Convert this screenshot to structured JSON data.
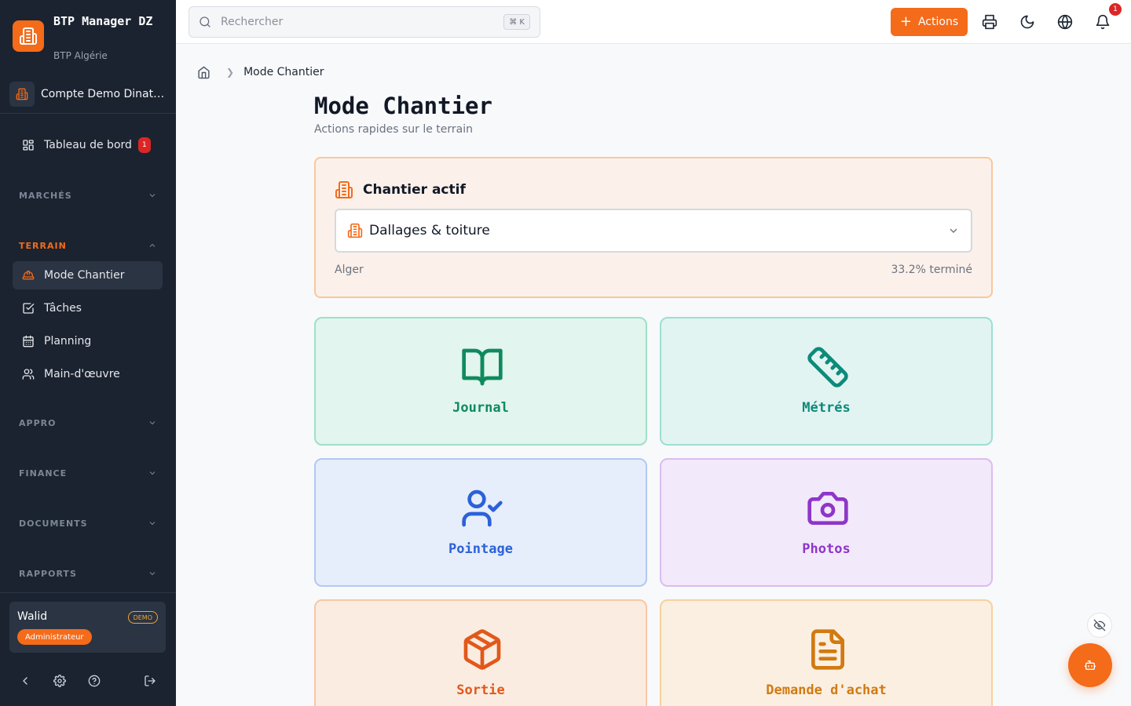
{
  "sidebar": {
    "brand_title": "BTP Manager DZ",
    "brand_subtitle": "BTP Algérie",
    "account": "Compte Demo Dinateur",
    "dashboard": {
      "label": "Tableau de bord",
      "badge": "1"
    },
    "sections": {
      "marches": "MARCHÉS",
      "terrain": "TERRAIN",
      "appro": "APPRO",
      "finance": "FINANCE",
      "documents": "DOCUMENTS",
      "rapports": "RAPPORTS"
    },
    "terrain_items": [
      {
        "label": "Mode Chantier",
        "icon": "hard-hat-icon",
        "active": true
      },
      {
        "label": "Tâches",
        "icon": "task-check-icon",
        "active": false
      },
      {
        "label": "Planning",
        "icon": "calendar-icon",
        "active": false
      },
      {
        "label": "Main-d'œuvre",
        "icon": "users-icon",
        "active": false
      }
    ],
    "user": {
      "name": "Walid",
      "demo_badge": "DEMO",
      "role": "Administrateur"
    },
    "footer_icons": [
      "chevron-left-icon",
      "settings-icon",
      "help-icon",
      "logout-icon"
    ]
  },
  "topbar": {
    "search_placeholder": "Rechercher",
    "search_shortcut": "⌘ K",
    "actions_label": "Actions",
    "notifications_count": "1",
    "icons": [
      "printer-icon",
      "moon-icon",
      "globe-icon",
      "bell-icon"
    ]
  },
  "breadcrumb": {
    "current": "Mode Chantier"
  },
  "page": {
    "title": "Mode Chantier",
    "subtitle": "Actions rapides sur le terrain"
  },
  "active_site": {
    "heading": "Chantier actif",
    "selected": "Dallages & toiture",
    "city": "Alger",
    "progress_text": "33.2% terminé"
  },
  "tiles": {
    "journal": "Journal",
    "metres": "Métrés",
    "pointage": "Pointage",
    "photos": "Photos",
    "sortie": "Sortie",
    "demande_achat": "Demande d'achat"
  },
  "colors": {
    "accent": "#f46b1a",
    "sidebar_bg": "#1b2330",
    "badge_red": "#dc2626"
  }
}
